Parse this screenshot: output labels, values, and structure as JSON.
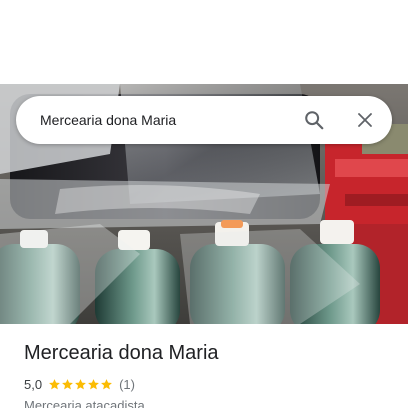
{
  "search": {
    "query": "Mercearia dona Maria",
    "search_icon": "search-icon",
    "close_icon": "close-icon"
  },
  "hero": {
    "subject": "place-photo"
  },
  "place": {
    "name": "Mercearia dona Maria",
    "rating": "5,0",
    "rating_stars": 5,
    "review_count": "(1)",
    "category": "Mercearia atacadista"
  },
  "colors": {
    "star": "#fbbc04",
    "text_primary": "#202124",
    "text_secondary": "#70757a",
    "icon": "#5f6368"
  }
}
